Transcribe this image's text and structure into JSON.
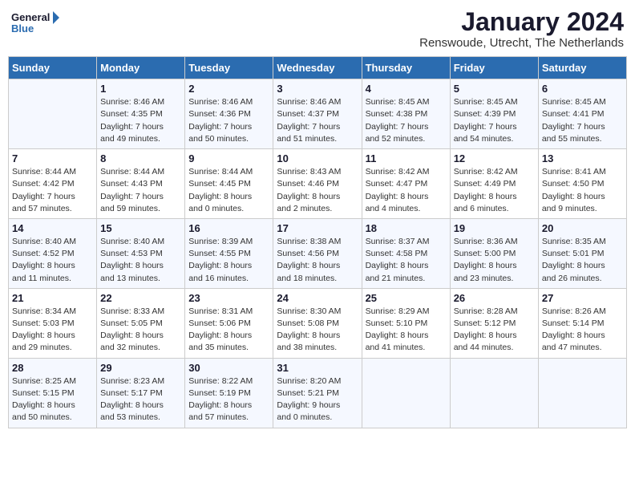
{
  "logo": {
    "line1": "General",
    "line2": "Blue"
  },
  "title": "January 2024",
  "subtitle": "Renswoude, Utrecht, The Netherlands",
  "weekdays": [
    "Sunday",
    "Monday",
    "Tuesday",
    "Wednesday",
    "Thursday",
    "Friday",
    "Saturday"
  ],
  "weeks": [
    [
      {
        "day": "",
        "info": ""
      },
      {
        "day": "1",
        "info": "Sunrise: 8:46 AM\nSunset: 4:35 PM\nDaylight: 7 hours\nand 49 minutes."
      },
      {
        "day": "2",
        "info": "Sunrise: 8:46 AM\nSunset: 4:36 PM\nDaylight: 7 hours\nand 50 minutes."
      },
      {
        "day": "3",
        "info": "Sunrise: 8:46 AM\nSunset: 4:37 PM\nDaylight: 7 hours\nand 51 minutes."
      },
      {
        "day": "4",
        "info": "Sunrise: 8:45 AM\nSunset: 4:38 PM\nDaylight: 7 hours\nand 52 minutes."
      },
      {
        "day": "5",
        "info": "Sunrise: 8:45 AM\nSunset: 4:39 PM\nDaylight: 7 hours\nand 54 minutes."
      },
      {
        "day": "6",
        "info": "Sunrise: 8:45 AM\nSunset: 4:41 PM\nDaylight: 7 hours\nand 55 minutes."
      }
    ],
    [
      {
        "day": "7",
        "info": "Sunrise: 8:44 AM\nSunset: 4:42 PM\nDaylight: 7 hours\nand 57 minutes."
      },
      {
        "day": "8",
        "info": "Sunrise: 8:44 AM\nSunset: 4:43 PM\nDaylight: 7 hours\nand 59 minutes."
      },
      {
        "day": "9",
        "info": "Sunrise: 8:44 AM\nSunset: 4:45 PM\nDaylight: 8 hours\nand 0 minutes."
      },
      {
        "day": "10",
        "info": "Sunrise: 8:43 AM\nSunset: 4:46 PM\nDaylight: 8 hours\nand 2 minutes."
      },
      {
        "day": "11",
        "info": "Sunrise: 8:42 AM\nSunset: 4:47 PM\nDaylight: 8 hours\nand 4 minutes."
      },
      {
        "day": "12",
        "info": "Sunrise: 8:42 AM\nSunset: 4:49 PM\nDaylight: 8 hours\nand 6 minutes."
      },
      {
        "day": "13",
        "info": "Sunrise: 8:41 AM\nSunset: 4:50 PM\nDaylight: 8 hours\nand 9 minutes."
      }
    ],
    [
      {
        "day": "14",
        "info": "Sunrise: 8:40 AM\nSunset: 4:52 PM\nDaylight: 8 hours\nand 11 minutes."
      },
      {
        "day": "15",
        "info": "Sunrise: 8:40 AM\nSunset: 4:53 PM\nDaylight: 8 hours\nand 13 minutes."
      },
      {
        "day": "16",
        "info": "Sunrise: 8:39 AM\nSunset: 4:55 PM\nDaylight: 8 hours\nand 16 minutes."
      },
      {
        "day": "17",
        "info": "Sunrise: 8:38 AM\nSunset: 4:56 PM\nDaylight: 8 hours\nand 18 minutes."
      },
      {
        "day": "18",
        "info": "Sunrise: 8:37 AM\nSunset: 4:58 PM\nDaylight: 8 hours\nand 21 minutes."
      },
      {
        "day": "19",
        "info": "Sunrise: 8:36 AM\nSunset: 5:00 PM\nDaylight: 8 hours\nand 23 minutes."
      },
      {
        "day": "20",
        "info": "Sunrise: 8:35 AM\nSunset: 5:01 PM\nDaylight: 8 hours\nand 26 minutes."
      }
    ],
    [
      {
        "day": "21",
        "info": "Sunrise: 8:34 AM\nSunset: 5:03 PM\nDaylight: 8 hours\nand 29 minutes."
      },
      {
        "day": "22",
        "info": "Sunrise: 8:33 AM\nSunset: 5:05 PM\nDaylight: 8 hours\nand 32 minutes."
      },
      {
        "day": "23",
        "info": "Sunrise: 8:31 AM\nSunset: 5:06 PM\nDaylight: 8 hours\nand 35 minutes."
      },
      {
        "day": "24",
        "info": "Sunrise: 8:30 AM\nSunset: 5:08 PM\nDaylight: 8 hours\nand 38 minutes."
      },
      {
        "day": "25",
        "info": "Sunrise: 8:29 AM\nSunset: 5:10 PM\nDaylight: 8 hours\nand 41 minutes."
      },
      {
        "day": "26",
        "info": "Sunrise: 8:28 AM\nSunset: 5:12 PM\nDaylight: 8 hours\nand 44 minutes."
      },
      {
        "day": "27",
        "info": "Sunrise: 8:26 AM\nSunset: 5:14 PM\nDaylight: 8 hours\nand 47 minutes."
      }
    ],
    [
      {
        "day": "28",
        "info": "Sunrise: 8:25 AM\nSunset: 5:15 PM\nDaylight: 8 hours\nand 50 minutes."
      },
      {
        "day": "29",
        "info": "Sunrise: 8:23 AM\nSunset: 5:17 PM\nDaylight: 8 hours\nand 53 minutes."
      },
      {
        "day": "30",
        "info": "Sunrise: 8:22 AM\nSunset: 5:19 PM\nDaylight: 8 hours\nand 57 minutes."
      },
      {
        "day": "31",
        "info": "Sunrise: 8:20 AM\nSunset: 5:21 PM\nDaylight: 9 hours\nand 0 minutes."
      },
      {
        "day": "",
        "info": ""
      },
      {
        "day": "",
        "info": ""
      },
      {
        "day": "",
        "info": ""
      }
    ]
  ]
}
